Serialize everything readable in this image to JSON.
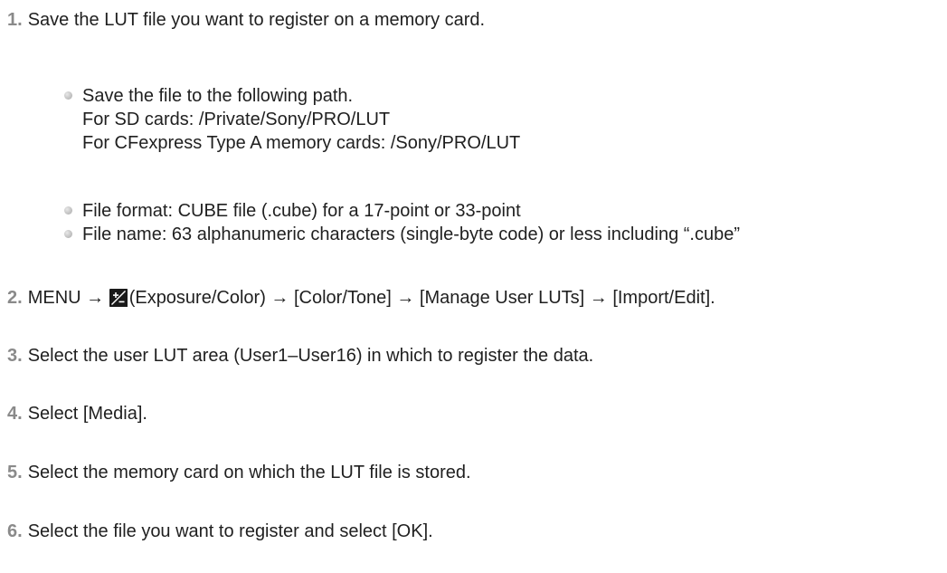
{
  "steps": [
    {
      "number": "1.",
      "text": "Save the LUT file you want to register on a memory card.",
      "bullets": [
        {
          "lines": [
            "Save the file to the following path.",
            "For SD cards: /Private/Sony/PRO/LUT",
            "For CFexpress Type A memory cards: /Sony/PRO/LUT"
          ]
        },
        {
          "lines": [
            "File format: CUBE file (.cube) for a 17-point or 33-point"
          ]
        },
        {
          "lines": [
            "File name: 63 alphanumeric characters (single-byte code) or less including “.cube”"
          ]
        }
      ]
    },
    {
      "number": "2.",
      "text_before_icon": "MENU → ",
      "icon": "exposure-color-icon",
      "text_after_icon": "(Exposure/Color) → [Color/Tone] → [Manage User LUTs] → [Import/Edit]."
    },
    {
      "number": "3.",
      "text": "Select the user LUT area (User1–User16) in which to register the data."
    },
    {
      "number": "4.",
      "text": "Select [Media]."
    },
    {
      "number": "5.",
      "text": "Select the memory card on which the LUT file is stored."
    },
    {
      "number": "6.",
      "text": "Select the file you want to register and select [OK]."
    }
  ],
  "colors": {
    "text": "#1f1f1f",
    "step_number": "#8a8a8a",
    "bullet": "#c4c4c4",
    "icon_bg": "#1a1a1a",
    "icon_fg": "#ffffff"
  }
}
